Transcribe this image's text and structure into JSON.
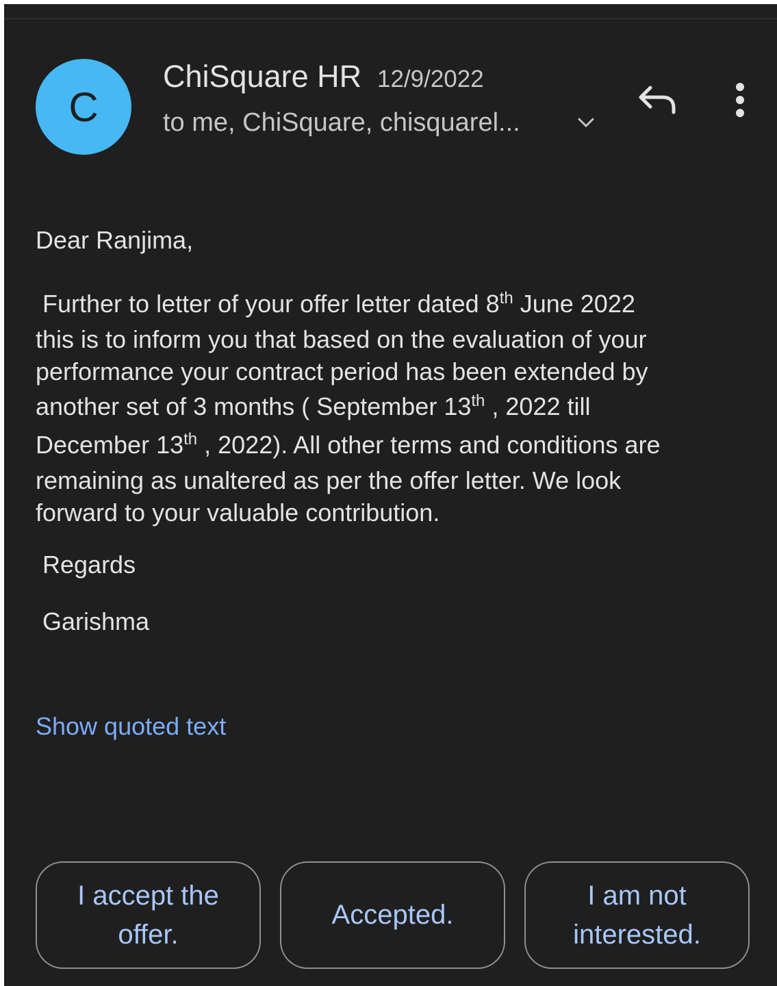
{
  "header": {
    "avatar_letter": "C",
    "sender_name": "ChiSquare HR",
    "date": "12/9/2022",
    "recipients": "to me, ChiSquare, chisquarel...",
    "avatar_color": "#46b8f4"
  },
  "icons": {
    "expand": "chevron-down-icon",
    "reply": "reply-icon",
    "more": "more-vert-icon"
  },
  "message": {
    "greeting": "Dear Ranjima,",
    "line1_pre": "Further to letter of your offer letter dated 8",
    "line1_sup": "th",
    "line1_post": " June 2022",
    "line2": "this is to inform you that based on the evaluation of your",
    "line3": "performance your contract period has been extended by",
    "line4_pre": "another set of 3 months ( September 13",
    "line4_sup": "th",
    "line4_post": " , 2022 till",
    "line5_pre": "December 13",
    "line5_sup": "th",
    "line5_post": " , 2022).  All other terms and conditions are",
    "line6": "remaining as unaltered as per the offer letter. We look",
    "line7": "forward to your valuable contribution.",
    "regards": "Regards",
    "signature": "Garishma"
  },
  "show_quoted_text": "Show quoted text",
  "smart_replies": [
    "I accept the offer.",
    "Accepted.",
    "I am not interested."
  ],
  "colors": {
    "background": "#1f1f1f",
    "link": "#7cacf8",
    "chip_text": "#a8c7fa"
  }
}
